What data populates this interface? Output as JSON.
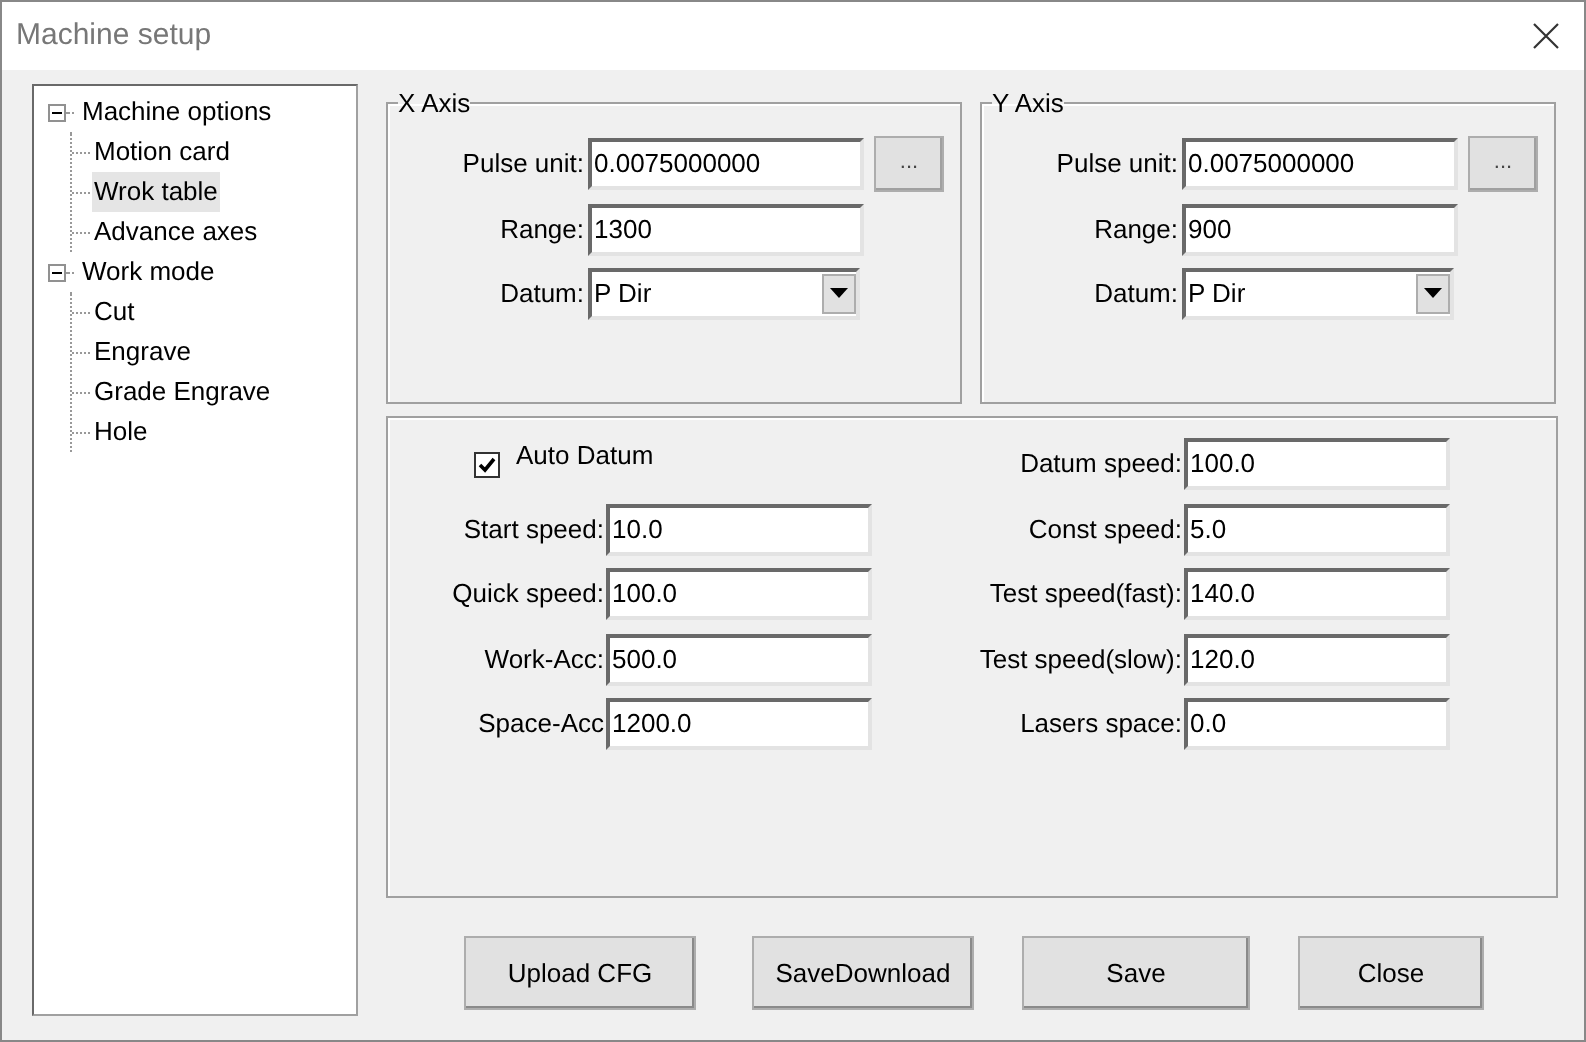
{
  "window": {
    "title": "Machine setup"
  },
  "tree": [
    {
      "label": "Machine options",
      "expanded": true,
      "selected": false,
      "children": [
        {
          "label": "Motion card",
          "selected": false
        },
        {
          "label": "Wrok table",
          "selected": true
        },
        {
          "label": "Advance axes",
          "selected": false
        }
      ]
    },
    {
      "label": "Work mode",
      "expanded": true,
      "selected": false,
      "children": [
        {
          "label": "Cut",
          "selected": false
        },
        {
          "label": "Engrave",
          "selected": false
        },
        {
          "label": "Grade Engrave",
          "selected": false
        },
        {
          "label": "Hole",
          "selected": false
        }
      ]
    }
  ],
  "axes": [
    {
      "title": "X Axis",
      "fields": [
        {
          "kind": "text",
          "label": "Pulse unit:",
          "value": "0.0075000000",
          "button": "..."
        },
        {
          "kind": "text",
          "label": "Range:",
          "value": "1300"
        },
        {
          "kind": "select",
          "label": "Datum:",
          "value": "P Dir"
        }
      ]
    },
    {
      "title": "Y Axis",
      "fields": [
        {
          "kind": "text",
          "label": "Pulse unit:",
          "value": "0.0075000000",
          "button": "..."
        },
        {
          "kind": "text",
          "label": "Range:",
          "value": "900"
        },
        {
          "kind": "select",
          "label": "Datum:",
          "value": "P Dir"
        }
      ]
    }
  ],
  "auto_datum": {
    "label": "Auto Datum",
    "checked": true
  },
  "left_fields": [
    {
      "label": "Start speed:",
      "value": "10.0"
    },
    {
      "label": "Quick speed:",
      "value": "100.0"
    },
    {
      "label": "Work-Acc:",
      "value": "500.0"
    },
    {
      "label": "Space-Acc",
      "value": "1200.0"
    }
  ],
  "right_fields": [
    {
      "label": "Datum speed:",
      "value": "100.0"
    },
    {
      "label": "Const speed:",
      "value": "5.0"
    },
    {
      "label": "Test speed(fast):",
      "value": "140.0"
    },
    {
      "label": "Test speed(slow):",
      "value": "120.0"
    },
    {
      "label": "Lasers space:",
      "value": "0.0"
    }
  ],
  "buttons": [
    "Upload CFG",
    "SaveDownload",
    "Save",
    "Close"
  ]
}
